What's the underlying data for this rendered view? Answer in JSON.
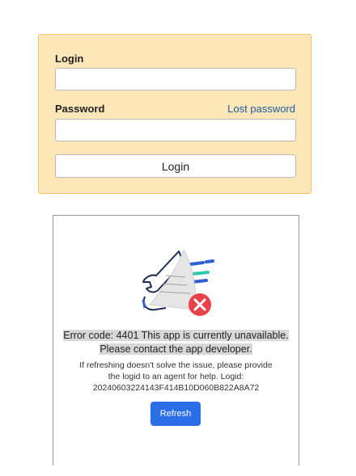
{
  "login": {
    "login_label": "Login",
    "login_value": "",
    "password_label": "Password",
    "lost_password_link": "Lost password",
    "password_value": "",
    "submit_label": "Login"
  },
  "error": {
    "title_line1": "Error code: 4401 This app is currently unavailable.",
    "title_line2": "Please contact the app developer.",
    "detail_line1": "If refreshing doesn't solve the issue, please provide",
    "detail_line2": "the logid to an agent for help. Logid:",
    "detail_line3": "20240603224143F414B10D060B822A8A72",
    "refresh_label": "Refresh"
  },
  "colors": {
    "panel_background": "#fde7b9",
    "panel_border": "#f1c46a",
    "link": "#1c5c98",
    "refresh_button": "#2a6ee8",
    "error_badge": "#e8424a",
    "illustration_blue": "#2f5fd6",
    "illustration_teal": "#2fc9b0"
  }
}
